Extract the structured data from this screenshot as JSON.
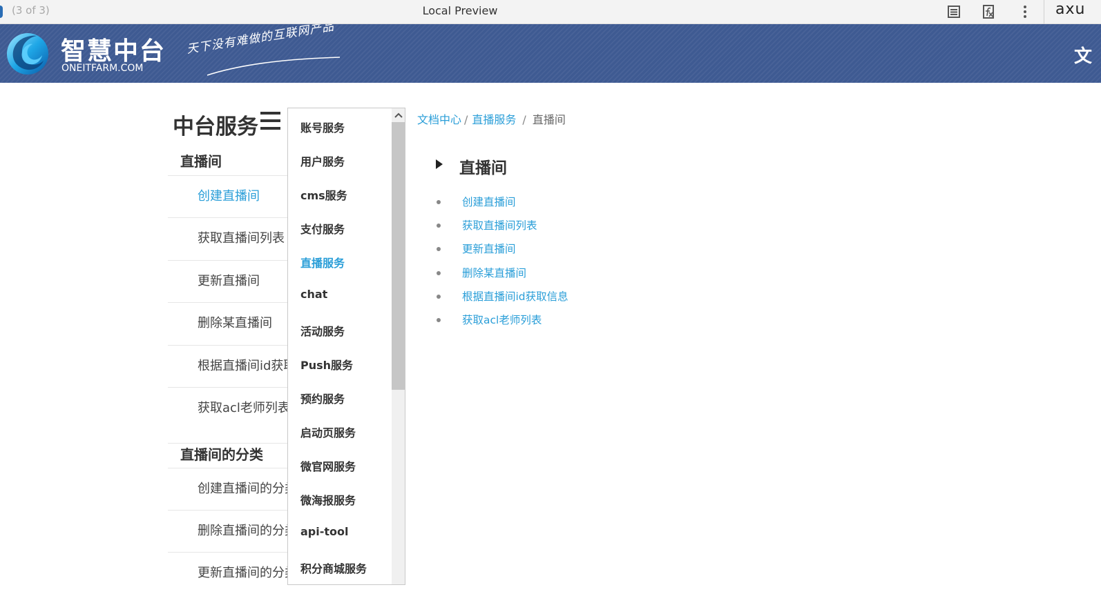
{
  "topbar": {
    "pager": "(3 of 3)",
    "title": "Local Preview",
    "brand": "axu",
    "icons": [
      "notes-icon",
      "function-icon",
      "more-vertical-icon"
    ]
  },
  "banner": {
    "site_name": "智慧中台",
    "domain": "ONEITFARM.COM",
    "slogan": "天下没有难做的互联网产品",
    "right_text": "文"
  },
  "sidebar": {
    "title": "中台服务",
    "groups": [
      {
        "label": "直播间",
        "items": [
          {
            "label": "创建直播间",
            "active": true
          },
          {
            "label": "获取直播间列表"
          },
          {
            "label": "更新直播间"
          },
          {
            "label": "删除某直播间"
          },
          {
            "label": "根据直播间id获取信息"
          },
          {
            "label": "获取acl老师列表"
          }
        ]
      },
      {
        "label": "直播间的分类",
        "items": [
          {
            "label": "创建直播间的分类"
          },
          {
            "label": "删除直播间的分类"
          },
          {
            "label": "更新直播间的分类"
          }
        ]
      }
    ]
  },
  "dropdown": {
    "items": [
      {
        "label": "账号服务"
      },
      {
        "label": "用户服务"
      },
      {
        "label": "cms服务"
      },
      {
        "label": "支付服务"
      },
      {
        "label": "直播服务",
        "active": true
      },
      {
        "label": "chat"
      },
      {
        "label": "活动服务"
      },
      {
        "label": "Push服务"
      },
      {
        "label": "预约服务"
      },
      {
        "label": "启动页服务"
      },
      {
        "label": "微官网服务"
      },
      {
        "label": "微海报服务"
      },
      {
        "label": "api-tool"
      },
      {
        "label": "积分商城服务"
      }
    ]
  },
  "main": {
    "breadcrumb": {
      "home": "文档中心",
      "sep1": "/",
      "section": "直播服务",
      "sep2": "/",
      "current": "直播间"
    },
    "title": "直播间",
    "links": [
      "创建直播间",
      "获取直播间列表",
      "更新直播间",
      "删除某直播间",
      "根据直播间id获取信息",
      "获取acl老师列表"
    ]
  },
  "colors": {
    "accent": "#2a9ed8",
    "banner": "#3e5a92",
    "text": "#333333"
  }
}
